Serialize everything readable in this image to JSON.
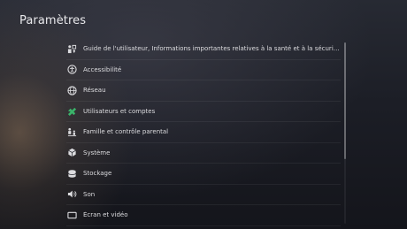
{
  "screen": {
    "title": "Paramètres"
  },
  "menu": {
    "items": [
      {
        "label": "Guide de l'utilisateur, Informations importantes relatives à la santé et à la sécurité et au...",
        "icon": "user-guide-icon"
      },
      {
        "label": "Accessibilité",
        "icon": "accessibility-icon"
      },
      {
        "label": "Réseau",
        "icon": "globe-icon"
      },
      {
        "label": "Utilisateurs et comptes",
        "icon": "users-accounts-icon"
      },
      {
        "label": "Famille et contrôle parental",
        "icon": "family-icon"
      },
      {
        "label": "Système",
        "icon": "system-cube-icon"
      },
      {
        "label": "Stockage",
        "icon": "storage-icon"
      },
      {
        "label": "Son",
        "icon": "speaker-icon"
      },
      {
        "label": "Écran et vidéo",
        "icon": "display-icon"
      }
    ]
  },
  "colors": {
    "accent_green": "#3bb36a",
    "text": "#dcdcdf"
  }
}
